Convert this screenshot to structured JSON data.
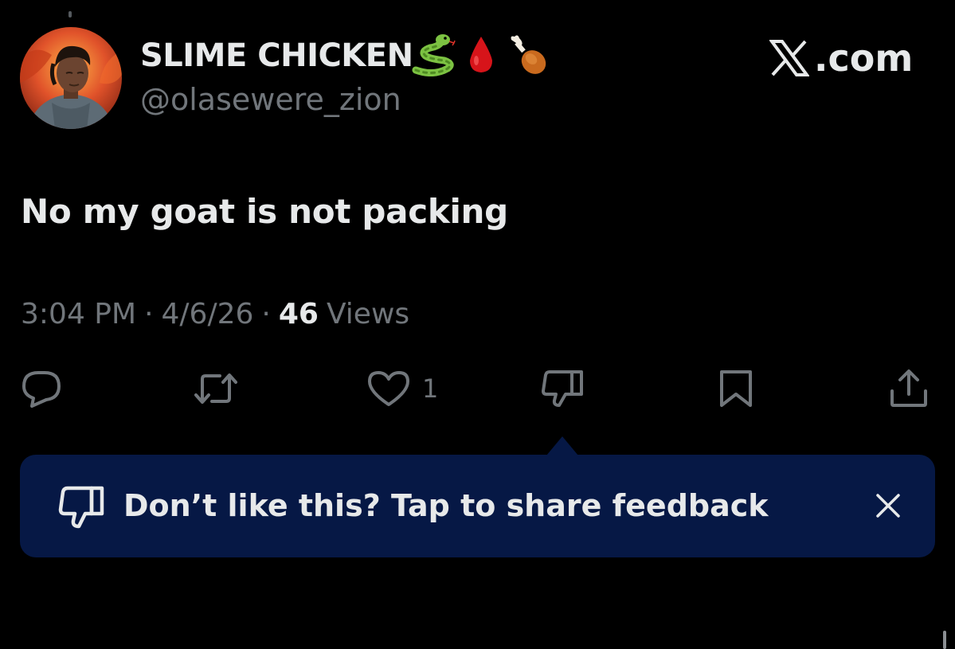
{
  "author": {
    "display_name": "SLIME CHICKEN",
    "name_emojis": [
      "snake-emoji",
      "drop-of-blood-emoji",
      "poultry-leg-emoji"
    ],
    "handle": "@olasewere_zion"
  },
  "brand": {
    "text": ".com",
    "logo": "x-logo-icon"
  },
  "tweet": {
    "text": "No my goat is not packing"
  },
  "meta": {
    "time": "3:04 PM",
    "separator": "·",
    "date": "4/6/26",
    "views_count": "46",
    "views_label": "Views"
  },
  "actions": {
    "reply_icon": "reply-icon",
    "repost_icon": "repost-icon",
    "like_icon": "heart-icon",
    "like_count": "1",
    "dislike_icon": "thumbs-down-icon",
    "bookmark_icon": "bookmark-icon",
    "share_icon": "share-icon"
  },
  "feedback_banner": {
    "text": "Don’t like this? Tap to share feedback",
    "icon": "thumbs-down-icon",
    "close_icon": "close-icon"
  },
  "colors": {
    "background": "#000000",
    "text_primary": "#e7e9ea",
    "text_secondary": "#71767b",
    "banner_bg": "#061845"
  }
}
